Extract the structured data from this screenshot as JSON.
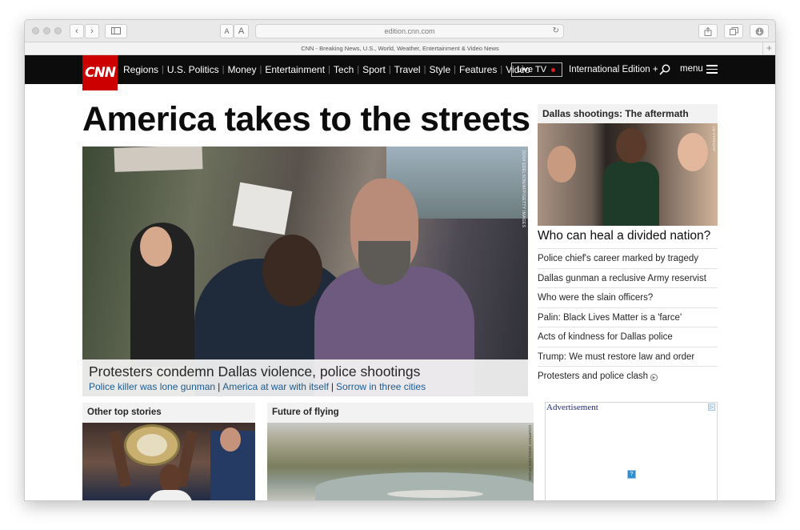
{
  "browser": {
    "url": "edition.cnn.com",
    "tab_title": "CNN - Breaking News, U.S., World, Weather, Entertainment & Video News",
    "font_small_label": "A",
    "font_large_label": "A"
  },
  "nav": {
    "logo": "CNN",
    "items": [
      "Regions",
      "U.S. Politics",
      "Money",
      "Entertainment",
      "Tech",
      "Sport",
      "Travel",
      "Style",
      "Features",
      "Video"
    ],
    "live_tv": "Live TV",
    "edition": "International Edition +",
    "menu": "menu"
  },
  "main": {
    "headline": "America takes to the streets",
    "hero_credit": "JOSH EDELSON/AFP/GETTY IMAGES",
    "caption_title": "Protesters condemn Dallas violence, police shootings",
    "caption_links": [
      "Police killer was lone gunman",
      "America at war with itself",
      "Sorrow in three cities"
    ]
  },
  "right_column": {
    "section_title": "Dallas shootings: The aftermath",
    "image_credit": "LM OTERO/AP",
    "lead": "Who can heal a divided nation?",
    "links": [
      "Police chief's career marked by tragedy",
      "Dallas gunman a reclusive Army reservist",
      "Who were the slain officers?",
      "Palin: Black Lives Matter is a 'farce'",
      "Acts of kindness for Dallas police",
      "Trump: We must restore law and order",
      "Protesters and police clash"
    ]
  },
  "sections": {
    "other_top_stories": "Other top stories",
    "future_of_flying": "Future of flying",
    "flying_credit": "COURTESY ZENGUSEN STUDIO"
  },
  "ad": {
    "label": "Advertisement",
    "choice_icon": "▷",
    "placeholder": "?"
  },
  "colors": {
    "brand_red": "#cc0000",
    "nav_bg": "#0c0c0c",
    "link_blue": "#1b5b92"
  }
}
